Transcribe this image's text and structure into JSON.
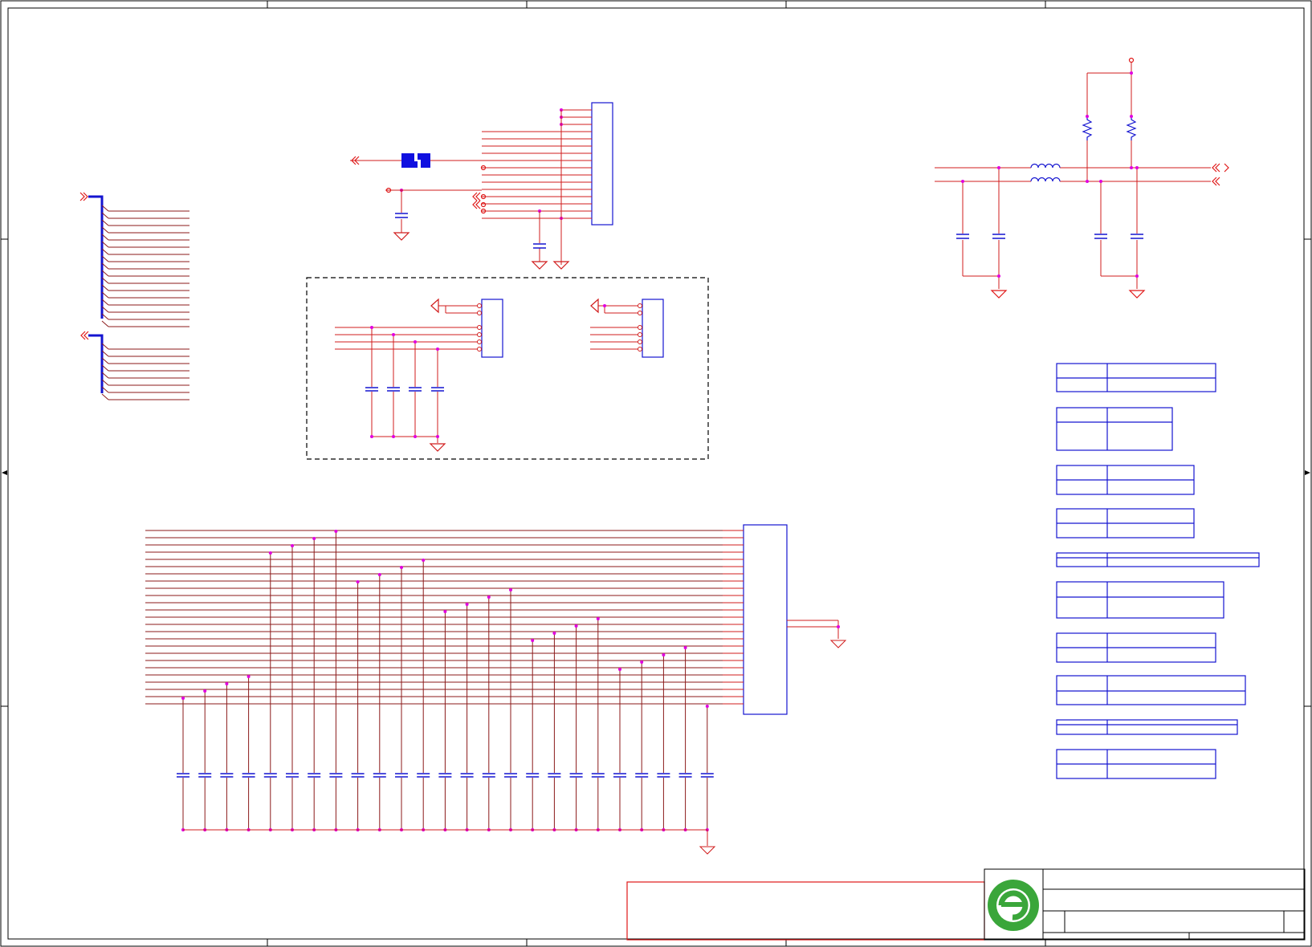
{
  "sheet": {
    "title": "",
    "colors": {
      "net": "#d11c1c",
      "bus_wire": "#8b1a1a",
      "part": "#1414d0",
      "bus": "#1414d0",
      "junction": "#e000e0",
      "frame": "#000000",
      "flag": "#e01818",
      "logo_green": "#3aa63a"
    }
  },
  "title_block": {
    "logo": "green-e-logo",
    "fields": [
      "",
      "",
      "",
      ""
    ]
  },
  "notes": {
    "dashed_group": "optional-connector-group"
  }
}
